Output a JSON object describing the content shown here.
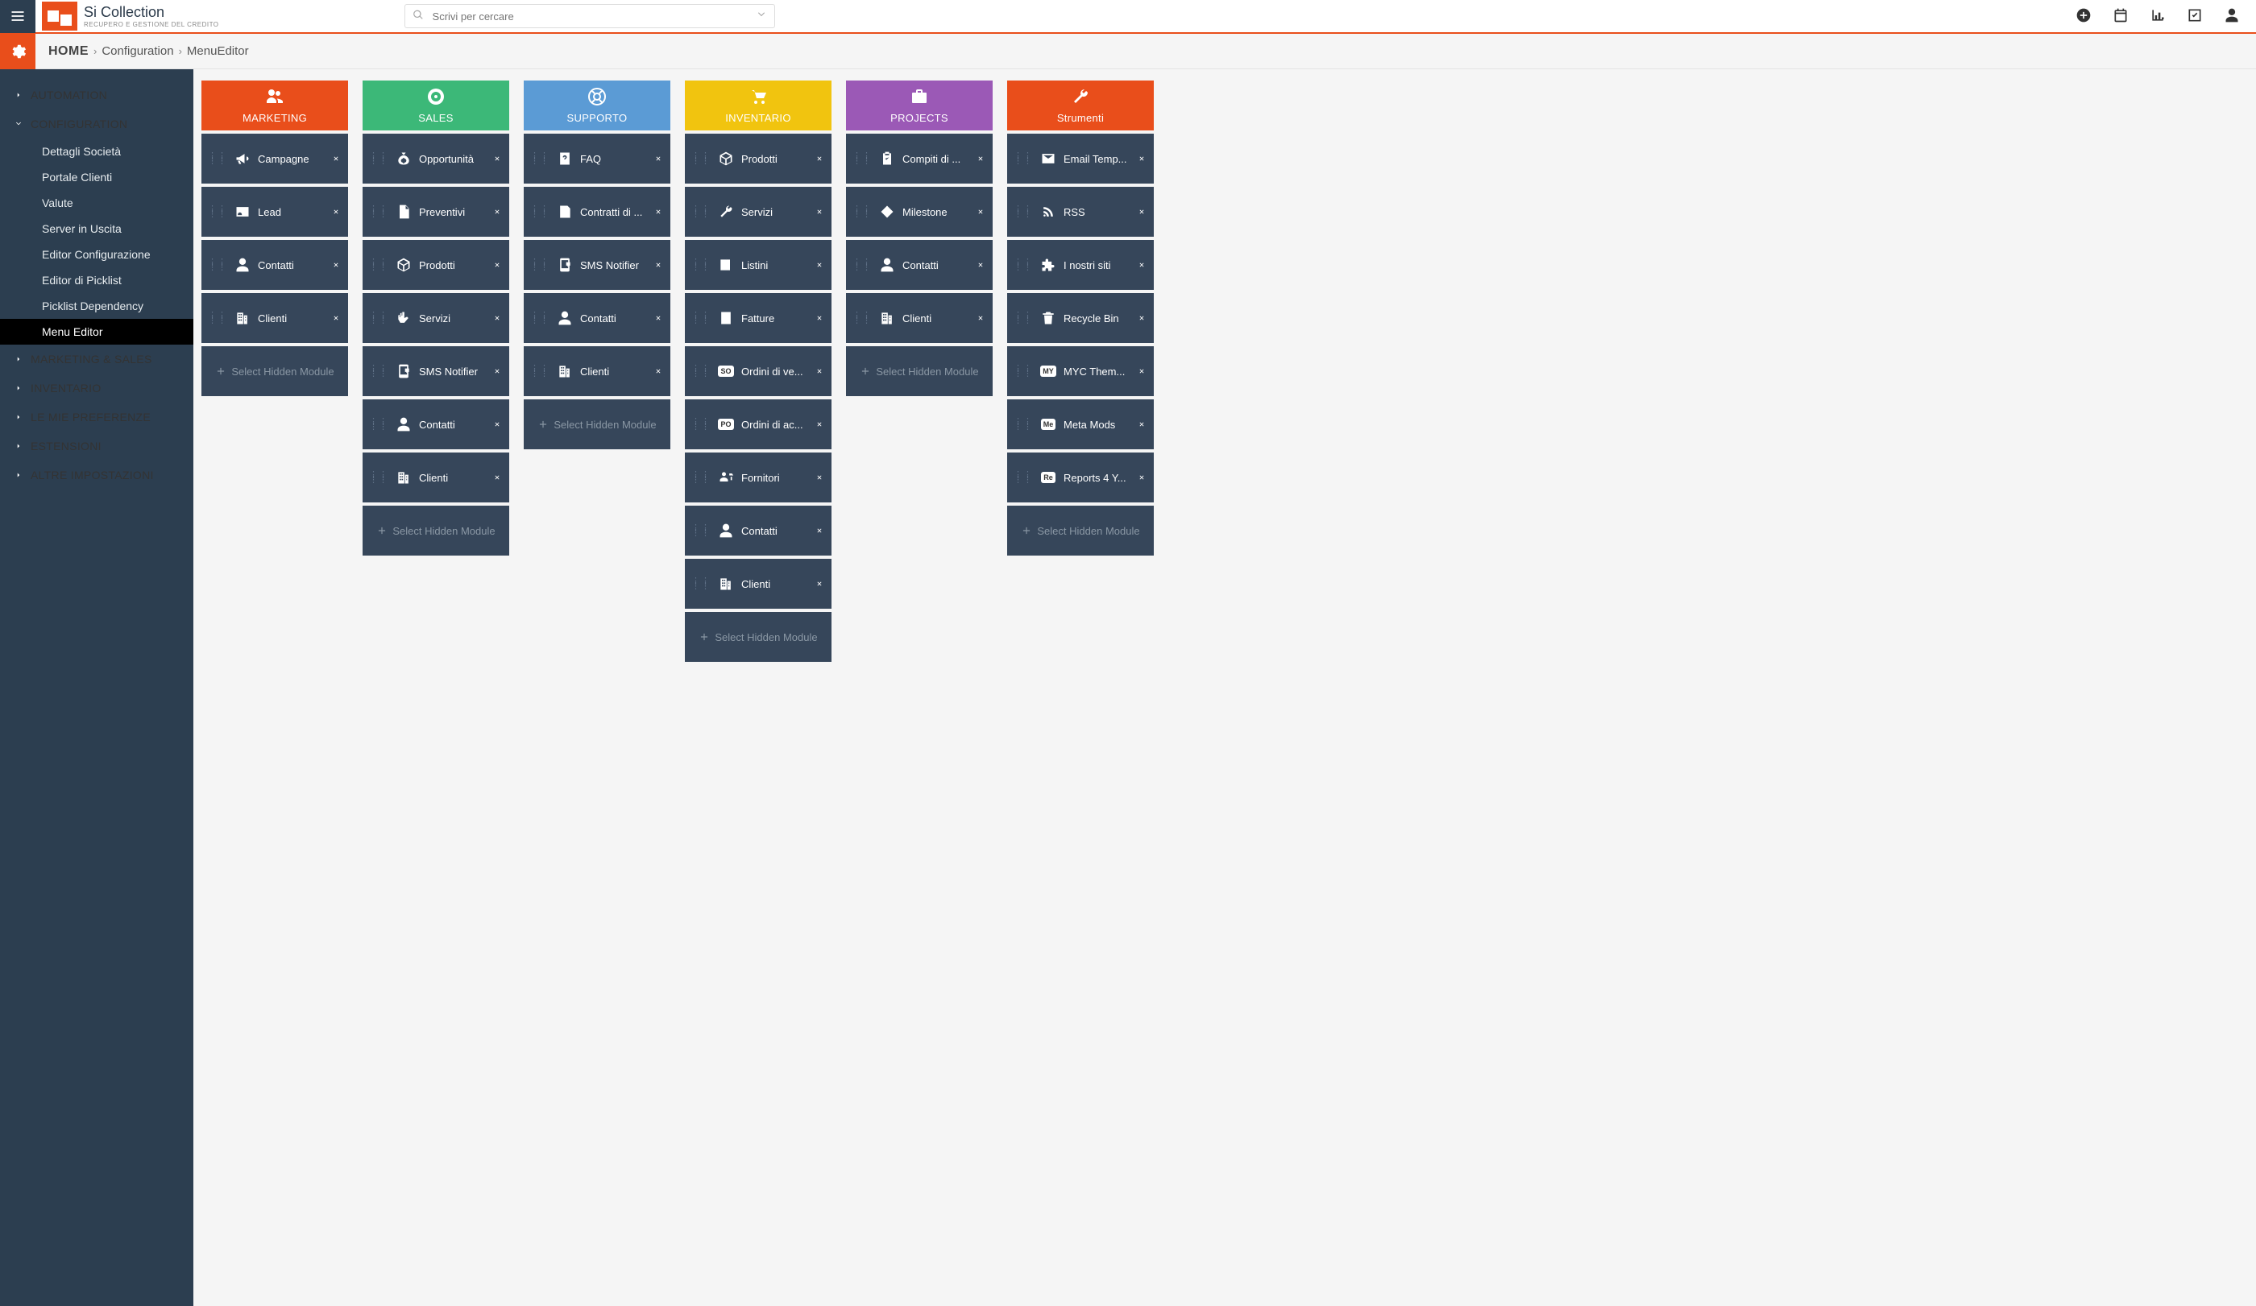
{
  "brand": {
    "name": "Si Collection",
    "tagline": "RECUPERO E GESTIONE DEL CREDITO"
  },
  "search": {
    "placeholder": "Scrivi per cercare"
  },
  "breadcrumb": {
    "home": "HOME",
    "level1": "Configuration",
    "level2": "MenuEditor"
  },
  "sidebar": {
    "groups": [
      {
        "label": "AUTOMATION",
        "expanded": false
      },
      {
        "label": "CONFIGURATION",
        "expanded": true,
        "items": [
          {
            "label": "Dettagli Società"
          },
          {
            "label": "Portale Clienti"
          },
          {
            "label": "Valute"
          },
          {
            "label": "Server in Uscita"
          },
          {
            "label": "Editor Configurazione"
          },
          {
            "label": "Editor di Picklist"
          },
          {
            "label": "Picklist Dependency"
          },
          {
            "label": "Menu Editor",
            "active": true
          }
        ]
      },
      {
        "label": "MARKETING & SALES",
        "expanded": false
      },
      {
        "label": "INVENTARIO",
        "expanded": false
      },
      {
        "label": "LE MIE PREFERENZE",
        "expanded": false
      },
      {
        "label": "ESTENSIONI",
        "expanded": false
      },
      {
        "label": "ALTRE IMPOSTAZIONI",
        "expanded": false
      }
    ]
  },
  "select_hidden": "Select Hidden Module",
  "columns": [
    {
      "label": "MARKETING",
      "color": "c-orange",
      "headicon": "users",
      "items": [
        {
          "icon": "bullhorn",
          "label": "Campagne"
        },
        {
          "icon": "idcard",
          "label": "Lead"
        },
        {
          "icon": "user",
          "label": "Contatti"
        },
        {
          "icon": "building",
          "label": "Clienti"
        }
      ]
    },
    {
      "label": "SALES",
      "color": "c-green",
      "headicon": "target",
      "items": [
        {
          "icon": "moneybag",
          "label": "Opportunità"
        },
        {
          "icon": "doc-search",
          "label": "Preventivi"
        },
        {
          "icon": "box-open",
          "label": "Prodotti"
        },
        {
          "icon": "handshake",
          "label": "Servizi"
        },
        {
          "icon": "sms",
          "label": "SMS Notifier"
        },
        {
          "icon": "user",
          "label": "Contatti"
        },
        {
          "icon": "building",
          "label": "Clienti"
        }
      ]
    },
    {
      "label": "SUPPORTO",
      "color": "c-blue",
      "headicon": "lifering",
      "items": [
        {
          "icon": "question",
          "label": "FAQ"
        },
        {
          "icon": "contract",
          "label": "Contratti di ..."
        },
        {
          "icon": "sms",
          "label": "SMS Notifier"
        },
        {
          "icon": "user",
          "label": "Contatti"
        },
        {
          "icon": "building",
          "label": "Clienti"
        }
      ]
    },
    {
      "label": "INVENTARIO",
      "color": "c-yellow",
      "headicon": "cart",
      "items": [
        {
          "icon": "box-open",
          "label": "Prodotti"
        },
        {
          "icon": "wrench",
          "label": "Servizi"
        },
        {
          "icon": "pricetag",
          "label": "Listini"
        },
        {
          "icon": "invoice",
          "label": "Fatture"
        },
        {
          "icon": "txt:SO",
          "label": "Ordini di ve..."
        },
        {
          "icon": "txt:PO",
          "label": "Ordini di ac..."
        },
        {
          "icon": "supplier",
          "label": "Fornitori"
        },
        {
          "icon": "user",
          "label": "Contatti"
        },
        {
          "icon": "building",
          "label": "Clienti"
        }
      ]
    },
    {
      "label": "PROJECTS",
      "color": "c-purple",
      "headicon": "briefcase",
      "items": [
        {
          "icon": "clipboard",
          "label": "Compiti di ..."
        },
        {
          "icon": "diamond",
          "label": "Milestone"
        },
        {
          "icon": "user",
          "label": "Contatti"
        },
        {
          "icon": "building",
          "label": "Clienti"
        }
      ]
    },
    {
      "label": "Strumenti",
      "color": "c-orange",
      "headicon": "wrench",
      "items": [
        {
          "icon": "envelope",
          "label": "Email Temp..."
        },
        {
          "icon": "rss",
          "label": "RSS"
        },
        {
          "icon": "puzzle",
          "label": "I nostri siti"
        },
        {
          "icon": "trash",
          "label": "Recycle Bin"
        },
        {
          "icon": "txt:MY",
          "label": "MYC Them..."
        },
        {
          "icon": "txt:Me",
          "label": "Meta Mods"
        },
        {
          "icon": "txt:Re",
          "label": "Reports 4 Y..."
        }
      ]
    }
  ]
}
